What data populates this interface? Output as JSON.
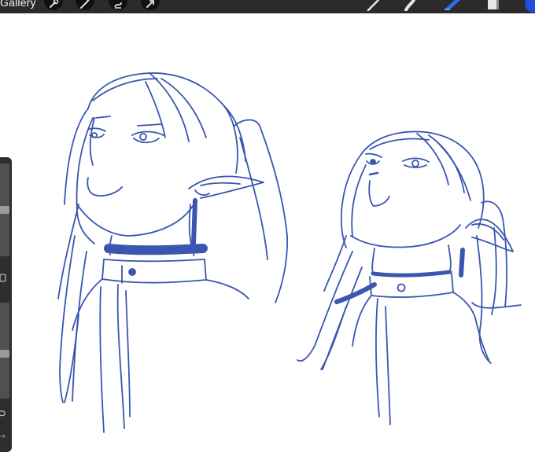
{
  "topbar": {
    "gallery_label": "Gallery",
    "left_tools": [
      "wrench-icon",
      "magic-wand-icon",
      "selection-icon",
      "transform-arrow-icon"
    ],
    "right_tools": [
      "brush-icon",
      "smudge-icon",
      "eraser-icon",
      "layers-icon",
      "color-swatch-icon"
    ]
  },
  "colors": {
    "toolbar_bg": "#2b2b2d",
    "ink": "#3a56b0",
    "active_tool": "#2f6fe8",
    "current_color": "#1f4fd8",
    "sidebar_bg": "#2e2e2f"
  },
  "sidebar": {
    "controls": [
      "brush-size-slider",
      "modify-button",
      "opacity-slider",
      "undo-button",
      "redo-button"
    ]
  },
  "canvas": {
    "content": "sketch-two-elf-girls-looking-up"
  }
}
